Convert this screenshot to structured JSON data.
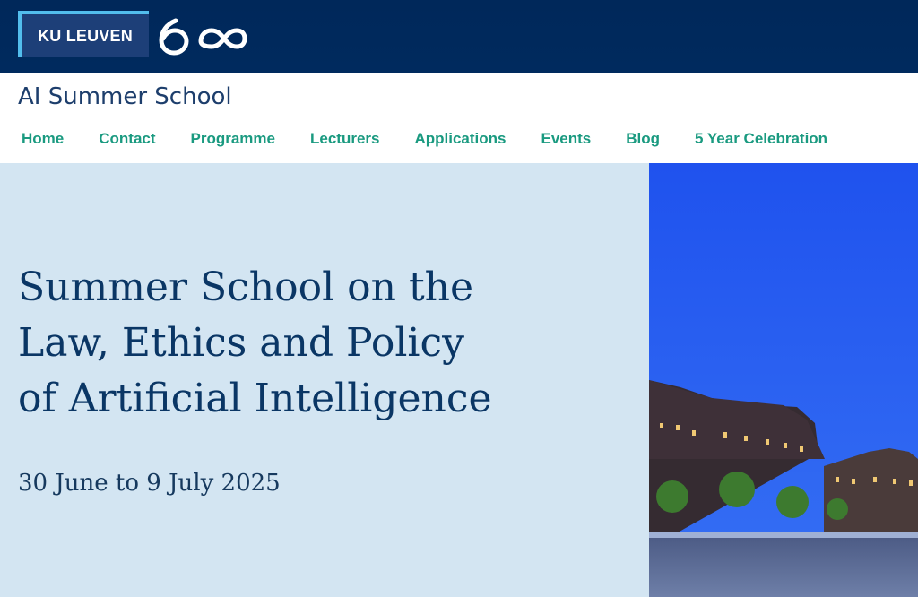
{
  "header": {
    "logo_text": "KU LEUVEN",
    "anniversary_mark": "600"
  },
  "site": {
    "title": "AI Summer School"
  },
  "nav": {
    "items": [
      "Home",
      "Contact",
      "Programme",
      "Lecturers",
      "Applications",
      "Events",
      "Blog",
      "5 Year Celebration"
    ]
  },
  "hero": {
    "title_lines": [
      "Summer School on the",
      "Law, Ethics and Policy",
      "of Artificial Intelligence"
    ],
    "date": "30 June to 9 July 2025"
  },
  "colors": {
    "header_bg": "#00285a",
    "logo_accent": "#52bdec",
    "nav_text": "#1a9a80",
    "hero_bg": "#d3e5f2",
    "hero_text": "#0a3665"
  },
  "icons": {
    "anniversary": "ku-leuven-600-icon"
  }
}
